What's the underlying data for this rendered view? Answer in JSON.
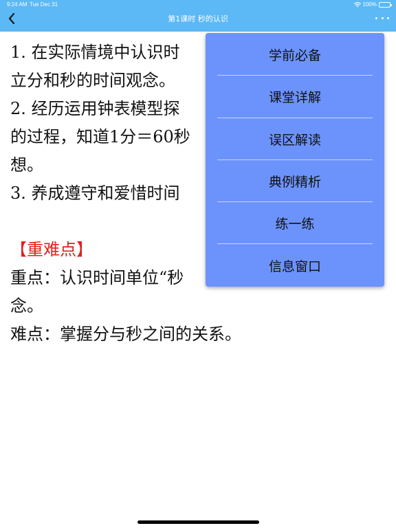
{
  "status_bar": {
    "time": "9:24 AM",
    "date": "Tue Dec 31",
    "battery": "100%",
    "icons": [
      "wifi-icon",
      "battery-icon"
    ]
  },
  "nav": {
    "title": "第1课时 秒的认识",
    "back_icon": "chevron-left-icon",
    "more_icon": "ellipsis-icon",
    "color": "#5cb9f6"
  },
  "content": {
    "lines": [
      "1. 在实际情境中认识时",
      "立分和秒的时间观念。",
      "2. 经历运用钟表模型探",
      "的过程，知道1分＝60秒",
      "想。",
      "3. 养成遵守和爱惜时间"
    ],
    "heading": "【重难点】",
    "heading_color": "#e0201c",
    "points": [
      "重点：认识时间单位“秒",
      "念。",
      "难点：掌握分与秒之间的关系。"
    ]
  },
  "menu": {
    "background": "#6c93fb",
    "items": [
      "学前必备",
      "课堂详解",
      "误区解读",
      "典例精析",
      "练一练",
      "信息窗口"
    ]
  }
}
